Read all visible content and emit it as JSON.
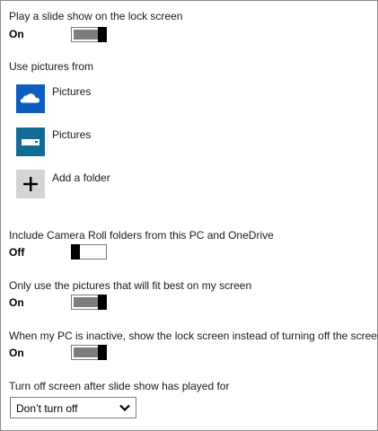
{
  "slideshow": {
    "heading": "Play a slide show on the lock screen",
    "state": "On",
    "on": true
  },
  "pictures_section": {
    "heading": "Use pictures from",
    "items": [
      {
        "label": "Pictures",
        "icon": "onedrive-cloud-icon",
        "color": "#0f5cbf"
      },
      {
        "label": "Pictures",
        "icon": "drive-icon",
        "color": "#136c96"
      },
      {
        "label": "Add a folder",
        "icon": "plus-icon",
        "color": "#d4d4d4"
      }
    ]
  },
  "camera_roll": {
    "heading": "Include Camera Roll folders from this PC and OneDrive",
    "state": "Off",
    "on": false
  },
  "fit_best": {
    "heading": "Only use the pictures that will fit best on my screen",
    "state": "On",
    "on": true
  },
  "inactive": {
    "heading": "When my PC is inactive, show the lock screen instead of turning off the screen",
    "state": "On",
    "on": true
  },
  "turn_off": {
    "heading": "Turn off screen after slide show has played for",
    "selected": "Don’t turn off",
    "chevron_icon": "chevron-down-icon"
  }
}
